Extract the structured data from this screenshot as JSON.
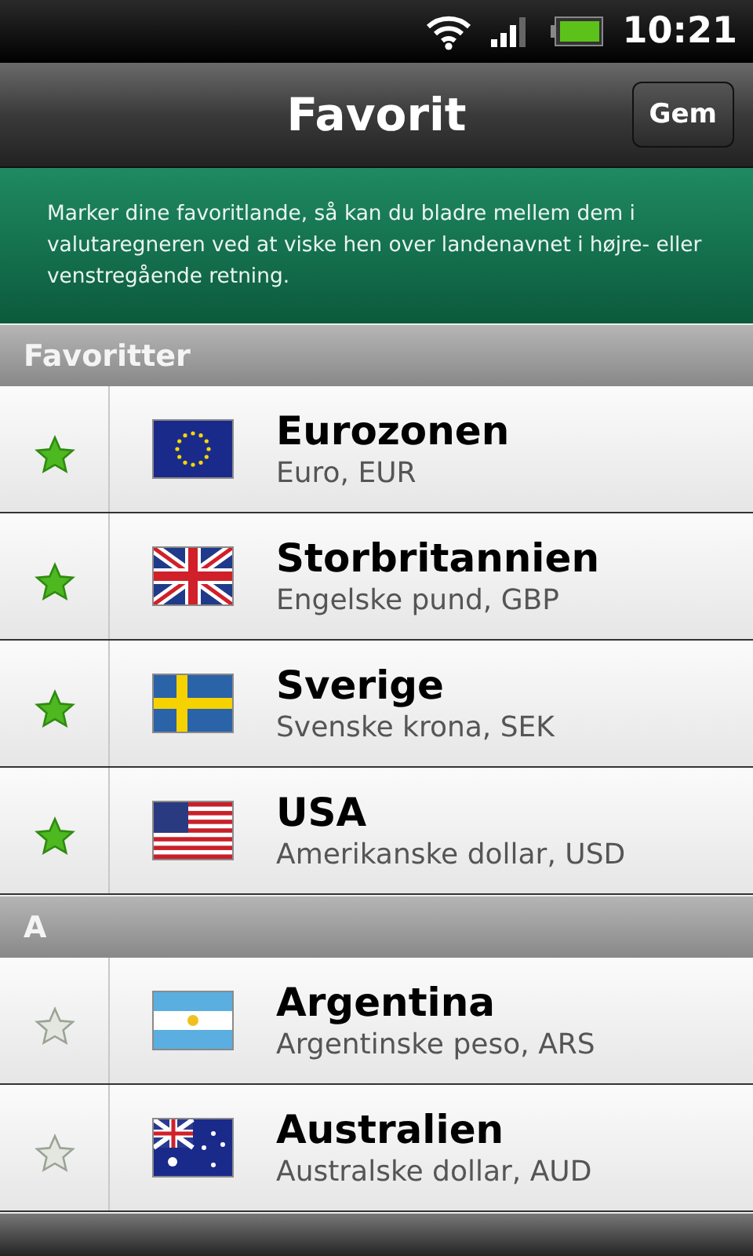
{
  "status_bar": {
    "time": "10:21"
  },
  "title_bar": {
    "title": "Favorit",
    "save_button": "Gem"
  },
  "info_banner": "Marker dine favoritlande, så kan du bladre mellem dem i valutaregneren ved at viske hen over landenavnet i højre- eller venstregående retning.",
  "sections": [
    {
      "header": "Favoritter",
      "rows": [
        {
          "name": "Eurozonen",
          "currency": "Euro, EUR",
          "checked": true
        },
        {
          "name": "Storbritannien",
          "currency": "Engelske pund, GBP",
          "checked": true
        },
        {
          "name": "Sverige",
          "currency": "Svenske krona, SEK",
          "checked": true
        },
        {
          "name": "USA",
          "currency": "Amerikanske dollar, USD",
          "checked": true
        }
      ]
    },
    {
      "header": "A",
      "rows": [
        {
          "name": "Argentina",
          "currency": "Argentinske peso, ARS",
          "checked": false
        },
        {
          "name": "Australien",
          "currency": "Australske dollar, AUD",
          "checked": false
        }
      ]
    }
  ]
}
